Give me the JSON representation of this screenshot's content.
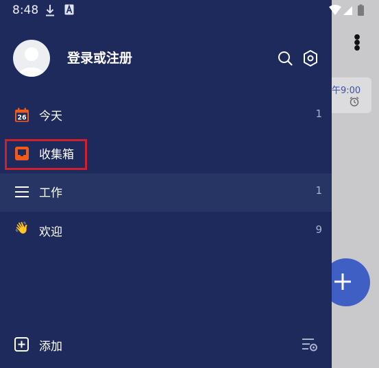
{
  "status_bar": {
    "time": "8:48"
  },
  "background": {
    "task_time": "午9:00"
  },
  "drawer": {
    "login_text": "登录或注册",
    "today": {
      "label": "今天",
      "count": "1",
      "calendar_day": "26"
    },
    "inbox": {
      "label": "收集箱"
    },
    "work": {
      "label": "工作",
      "count": "1"
    },
    "welcome": {
      "label": "欢迎",
      "count": "9",
      "emoji": "👋"
    },
    "add_label": "添加"
  },
  "colors": {
    "drawer_bg": "#1e2a5c",
    "selected_row": "#273565",
    "accent_orange": "#f05a1a",
    "highlight_red": "#d0202e",
    "fab_blue": "#3f5fc4"
  }
}
